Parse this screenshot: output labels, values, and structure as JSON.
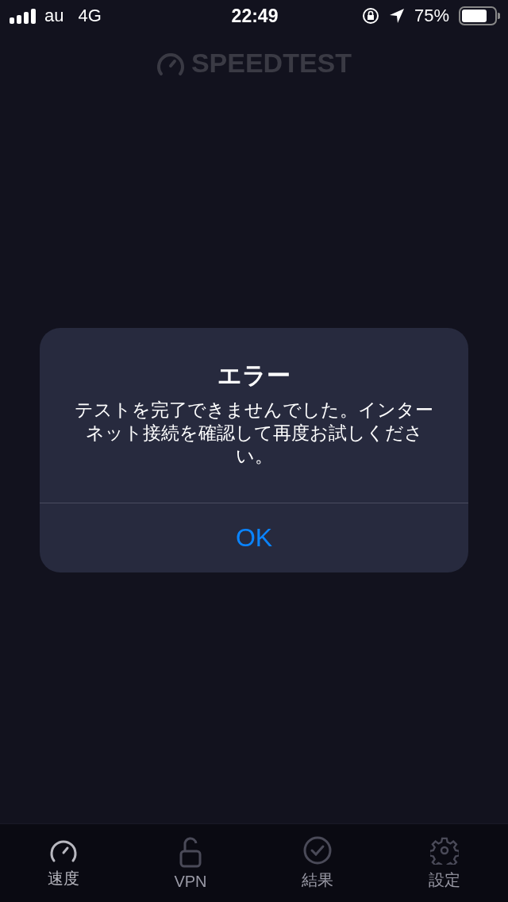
{
  "status_bar": {
    "carrier": "au",
    "network": "4G",
    "time": "22:49",
    "battery": "75%"
  },
  "app_logo": {
    "text": "SPEEDTEST"
  },
  "alert": {
    "title": "エラー",
    "message": "テストを完了できませんでした。インターネット接続を確認して再度お試しください。",
    "buttons": [
      "OK"
    ]
  },
  "tab_bar": [
    {
      "label": "速度",
      "kind": "gauge",
      "selected": true
    },
    {
      "label": "VPN",
      "kind": "lock",
      "selected": false
    },
    {
      "label": "結果",
      "kind": "check",
      "selected": false
    },
    {
      "label": "設定",
      "kind": "gear",
      "selected": false
    }
  ]
}
